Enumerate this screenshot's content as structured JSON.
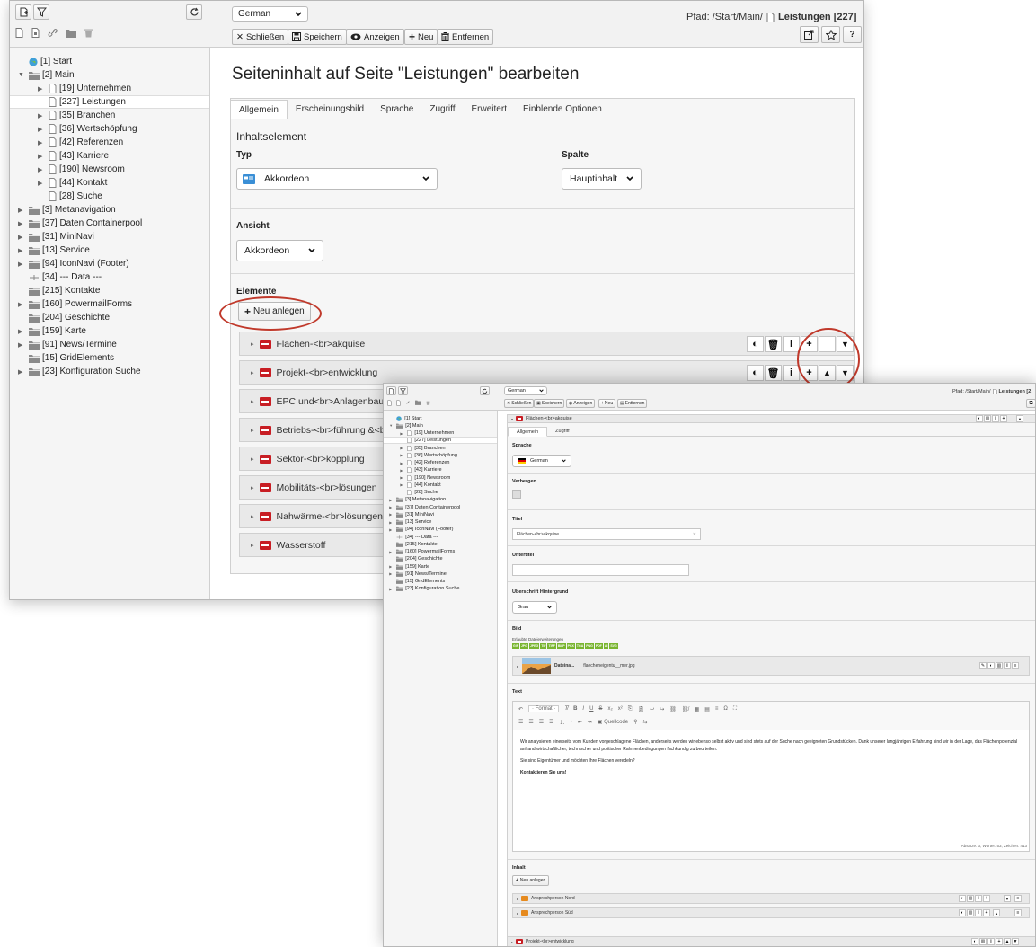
{
  "language": "German",
  "pfad": {
    "prefix": "Pfad: /Start/Main/",
    "page": "Leistungen [227]"
  },
  "toolbar": {
    "close": "Schließen",
    "save": "Speichern",
    "view": "Anzeigen",
    "new": "Neu",
    "delete": "Entfernen"
  },
  "page_title": "Seiteninhalt auf Seite \"Leistungen\" bearbeiten",
  "tabs": [
    "Allgemein",
    "Erscheinungsbild",
    "Sprache",
    "Zugriff",
    "Erweitert",
    "Einblende Optionen"
  ],
  "form": {
    "section": "Inhaltselement",
    "typ_label": "Typ",
    "typ_value": "Akkordeon",
    "spalte_label": "Spalte",
    "spalte_value": "Hauptinhalt",
    "ansicht_label": "Ansicht",
    "ansicht_value": "Akkordeon",
    "elemente_label": "Elemente",
    "new_button": "Neu anlegen"
  },
  "elements": [
    "Flächen-<br>akquise",
    "Projekt-<br>entwicklung",
    "EPC und<br>Anlagenbau",
    "Betriebs-<br>führung &<br>",
    "Sektor-<br>kopplung",
    "Mobilitäts-<br>lösungen",
    "Nahwärme-<br>lösungen",
    "Wasserstoff"
  ],
  "tree": [
    {
      "l": "[1] Start",
      "d": 0,
      "i": "globe"
    },
    {
      "l": "[2] Main",
      "d": 0,
      "i": "folder",
      "t": "open"
    },
    {
      "l": "[19] Unternehmen",
      "d": 1,
      "i": "page",
      "t": "closed"
    },
    {
      "l": "[227] Leistungen",
      "d": 1,
      "i": "page",
      "s": true
    },
    {
      "l": "[35] Branchen",
      "d": 1,
      "i": "page",
      "t": "closed"
    },
    {
      "l": "[36] Wertschöpfung",
      "d": 1,
      "i": "page",
      "t": "closed"
    },
    {
      "l": "[42] Referenzen",
      "d": 1,
      "i": "page",
      "t": "closed"
    },
    {
      "l": "[43] Karriere",
      "d": 1,
      "i": "page",
      "t": "closed"
    },
    {
      "l": "[190] Newsroom",
      "d": 1,
      "i": "page",
      "t": "closed"
    },
    {
      "l": "[44] Kontakt",
      "d": 1,
      "i": "page",
      "t": "closed"
    },
    {
      "l": "[28] Suche",
      "d": 1,
      "i": "page"
    },
    {
      "l": "[3] Metanavigation",
      "d": 0,
      "i": "folder",
      "t": "closed"
    },
    {
      "l": "[37] Daten Containerpool",
      "d": 0,
      "i": "folder",
      "t": "closed"
    },
    {
      "l": "[31] MiniNavi",
      "d": 0,
      "i": "folder",
      "t": "closed"
    },
    {
      "l": "[13] Service",
      "d": 0,
      "i": "folder",
      "t": "closed"
    },
    {
      "l": "[94] IconNavi (Footer)",
      "d": 0,
      "i": "folder",
      "t": "closed"
    },
    {
      "l": "[34] --- Data ---",
      "d": 0,
      "i": "divider"
    },
    {
      "l": "[215] Kontakte",
      "d": 0,
      "i": "folder"
    },
    {
      "l": "[160] PowermailForms",
      "d": 0,
      "i": "folder",
      "t": "closed"
    },
    {
      "l": "[204] Geschichte",
      "d": 0,
      "i": "folder"
    },
    {
      "l": "[159] Karte",
      "d": 0,
      "i": "folder",
      "t": "closed"
    },
    {
      "l": "[91] News/Termine",
      "d": 0,
      "i": "folder",
      "t": "closed"
    },
    {
      "l": "[15] GridElements",
      "d": 0,
      "i": "folder"
    },
    {
      "l": "[23] Konfiguration Suche",
      "d": 0,
      "i": "folder",
      "t": "closed"
    }
  ],
  "w2": {
    "pfad_prefix": "Pfad: /Start/Main/",
    "pfad_page": "Leistungen [2",
    "record_title": "Flächen-<br>akquise",
    "tabs": [
      "Allgemein",
      "Zugriff"
    ],
    "sprache_label": "Sprache",
    "sprache_value": "German",
    "verbergen_label": "Verbergen",
    "titel_label": "Titel",
    "titel_value": "Flächen-<br>akquise",
    "untertitel_label": "Untertitel",
    "ueberschrift_label": "Überschrift Hintergrund",
    "ueberschrift_value": "Grau",
    "bild_label": "Bild",
    "allowed_label": "Erlaubte Dateierweiterungen",
    "extensions": [
      "GIF",
      "JPG",
      "JPEG",
      "TIF",
      "TIFF",
      "BMP",
      "PCX",
      "TGA",
      "PNG",
      "PDF",
      "AI",
      "SVG"
    ],
    "file_label": "Dateina...",
    "file_name": "flaecheneigentu__mer.jpg",
    "text_label": "Text",
    "rte_format": "Format",
    "rte_source": "Quellcode",
    "text_p1": "Wir analysieren einerseits vom Kunden vorgeschlagene Flächen, anderseits werden wir ebenso selbst aktiv und sind stets auf der Suche nach geeigneten Grundstücken. Dank unserer langjährigen Erfahrung sind wir in der Lage, das Flächenpotenzial anhand wirtschaftlicher, technischer und politischer Rahmenbedingungen fachkundig zu beurteilen.",
    "text_p2": "Sie sind Eigentümer und möchten Ihre Flächen veredeln?",
    "text_p3": "Kontaktieren Sie uns!",
    "word_count": "Absätze: 3, Wörter: 53, Zeichen: 413",
    "inhalt_label": "Inhalt",
    "new_button": "Neu anlegen",
    "children": [
      "Ansprechperson Nord",
      "Ansprechperson Süd"
    ],
    "next_element": "Projekt-<br>entwicklung"
  },
  "colors": {
    "accent_red": "#c81e24",
    "badge_green": "#79b530",
    "annotation_ring": "#c0392b"
  }
}
